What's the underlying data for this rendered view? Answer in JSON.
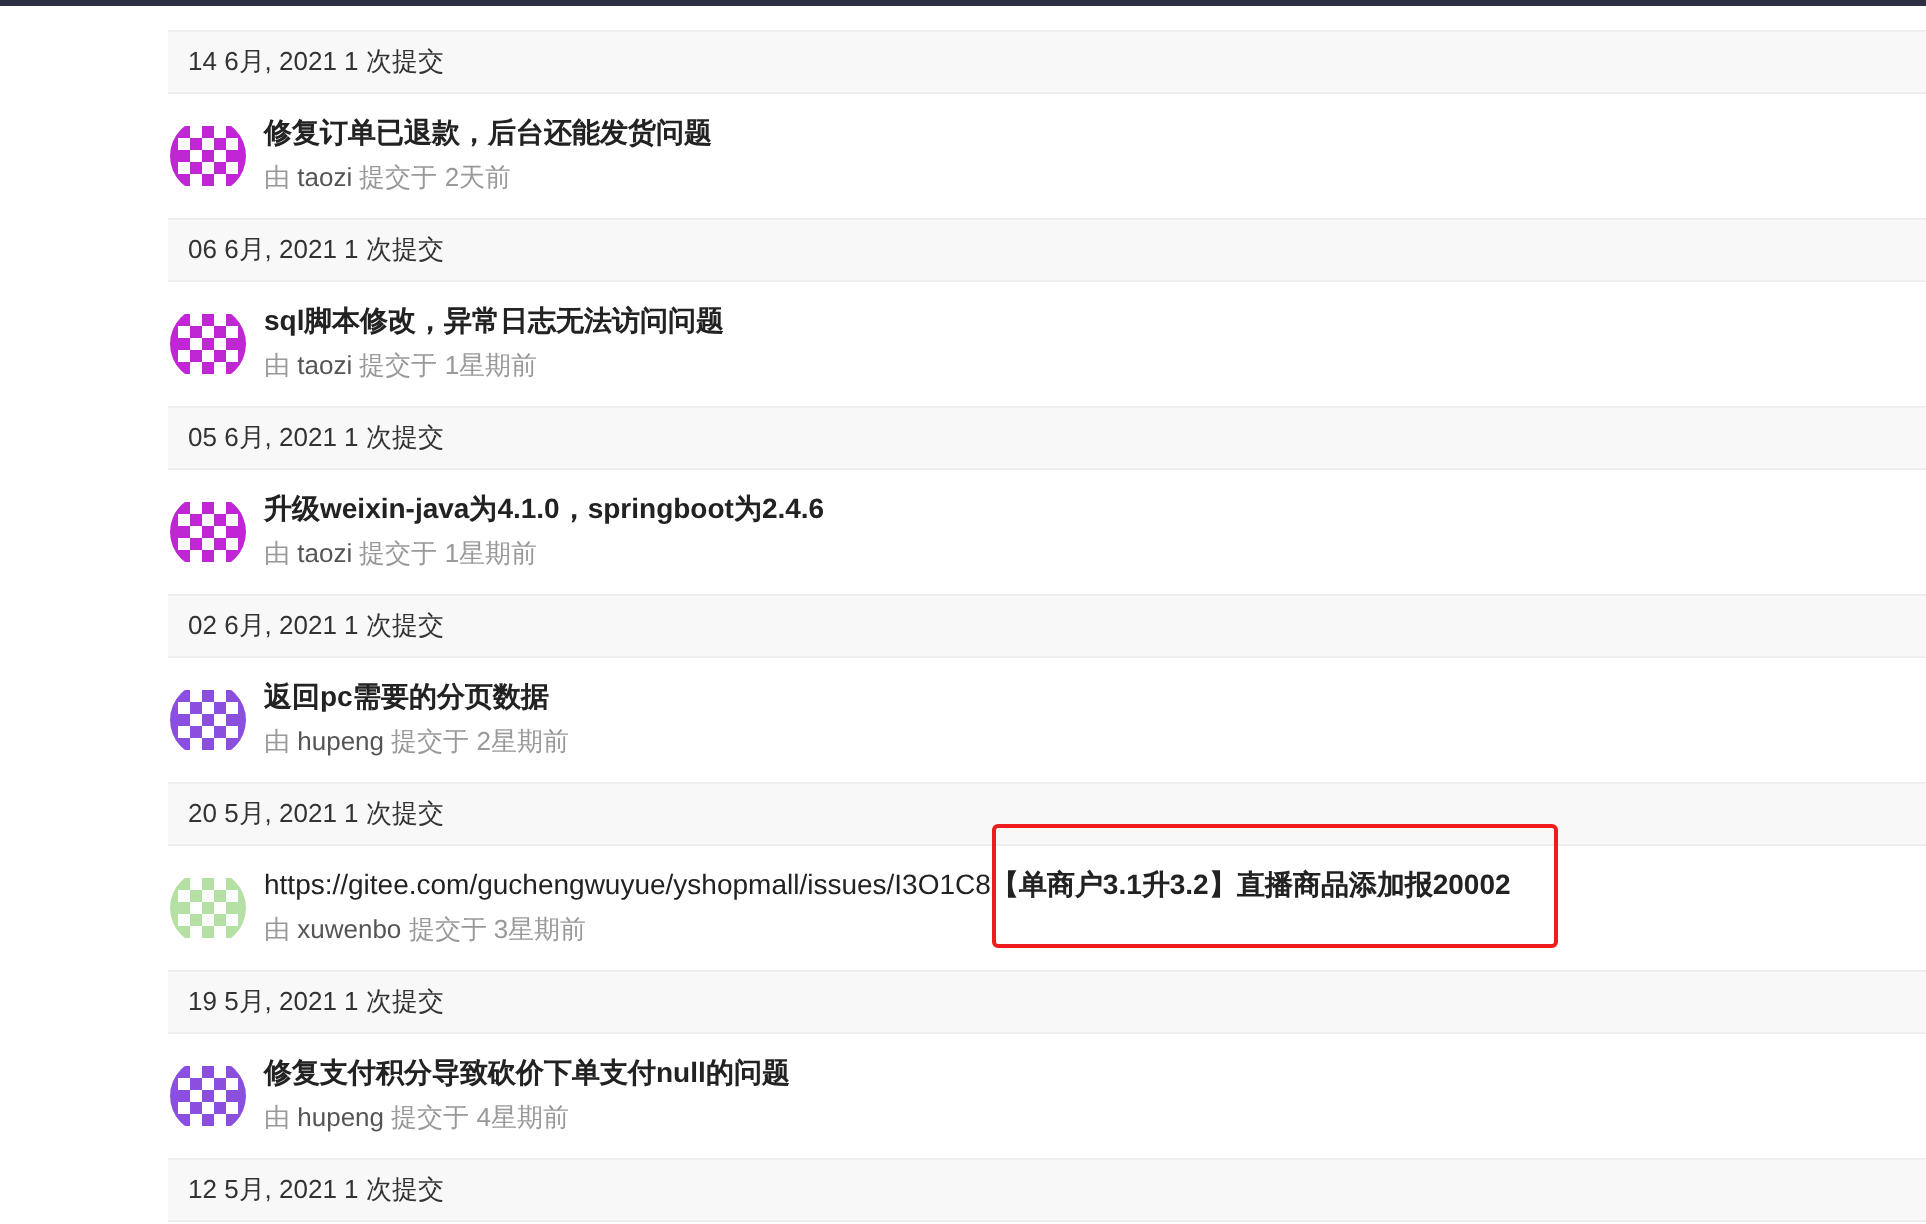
{
  "groups": [
    {
      "header": "14 6月, 2021 1 次提交",
      "commits": [
        {
          "title": "修复订单已退款，后台还能发货问题",
          "by": "由",
          "author": "taozi",
          "action": "提交于",
          "time": "2天前",
          "color": "#c026d3",
          "highlighted": false
        }
      ]
    },
    {
      "header": "06 6月, 2021 1 次提交",
      "commits": [
        {
          "title": "sql脚本修改，异常日志无法访问问题",
          "by": "由",
          "author": "taozi",
          "action": "提交于",
          "time": "1星期前",
          "color": "#c026d3",
          "highlighted": false
        }
      ]
    },
    {
      "header": "05 6月, 2021 1 次提交",
      "commits": [
        {
          "title": "升级weixin-java为4.1.0，springboot为2.4.6",
          "by": "由",
          "author": "taozi",
          "action": "提交于",
          "time": "1星期前",
          "color": "#c026d3",
          "highlighted": false
        }
      ]
    },
    {
      "header": "02 6月, 2021 1 次提交",
      "commits": [
        {
          "title": "返回pc需要的分页数据",
          "by": "由",
          "author": "hupeng",
          "action": "提交于",
          "time": "2星期前",
          "color": "#8b4fe0",
          "highlighted": false
        }
      ]
    },
    {
      "header": "20 5月, 2021 1 次提交",
      "commits": [
        {
          "title": "https://gitee.com/guchengwuyue/yshopmall/issues/I3O1C8**【单商户3.1升3.2】直播商品添加报20002**",
          "by": "由",
          "author": "xuwenbo",
          "action": "提交于",
          "time": "3星期前",
          "color": "#b5e0a4",
          "highlighted": true
        }
      ]
    },
    {
      "header": "19 5月, 2021 1 次提交",
      "commits": [
        {
          "title": "修复支付积分导致砍价下单支付null的问题",
          "by": "由",
          "author": "hupeng",
          "action": "提交于",
          "time": "4星期前",
          "color": "#8b4fe0",
          "highlighted": false
        }
      ]
    },
    {
      "header": "12 5月, 2021 1 次提交"
    }
  ]
}
